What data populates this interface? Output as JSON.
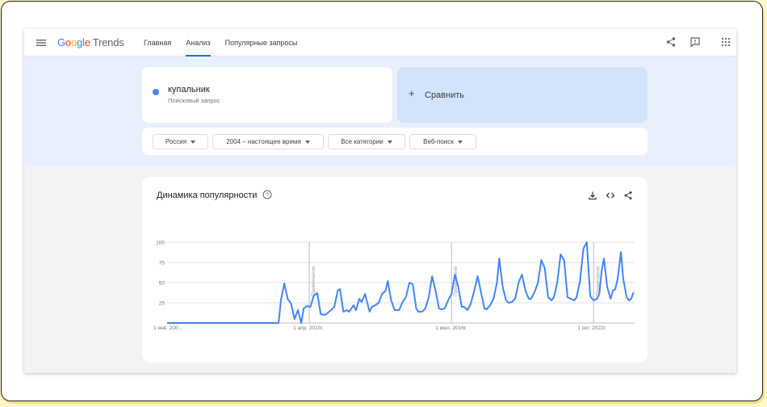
{
  "app": {
    "logo_google": "Google",
    "logo_trends": "Trends",
    "nav": [
      "Главная",
      "Анализ",
      "Популярные запросы"
    ],
    "active_tab": 1
  },
  "search": {
    "term": "купальник",
    "term_type": "Поисковый запрос",
    "term_color": "#4285f4",
    "compare_label": "Сравнить"
  },
  "filters": {
    "region": "Россия",
    "period": "2004 – настоящее время",
    "category": "Все категории",
    "search_type": "Веб-поиск"
  },
  "chart_data": {
    "type": "line",
    "title": "Динамика популярности",
    "x_tick_labels": [
      "1 янв. 200...",
      "1 апр. 2010г.",
      "1 июл. 2016г.",
      "1 окт. 2022г."
    ],
    "y_ticks": [
      100,
      75,
      50,
      25
    ],
    "ylim": [
      0,
      100
    ],
    "annotation_label": "Примечание",
    "series": [
      {
        "color": "#4285f4",
        "points": [
          [
            2004.0,
            0
          ],
          [
            2005.0,
            0
          ],
          [
            2006.0,
            0
          ],
          [
            2007.0,
            0
          ],
          [
            2008.0,
            0
          ],
          [
            2008.5,
            0
          ],
          [
            2008.9,
            0
          ],
          [
            2009.0,
            28
          ],
          [
            2009.15,
            49
          ],
          [
            2009.3,
            30
          ],
          [
            2009.45,
            24
          ],
          [
            2009.6,
            5
          ],
          [
            2009.75,
            16
          ],
          [
            2009.9,
            0
          ],
          [
            2010.0,
            18
          ],
          [
            2010.15,
            21
          ],
          [
            2010.3,
            20
          ],
          [
            2010.45,
            34
          ],
          [
            2010.6,
            37
          ],
          [
            2010.75,
            11
          ],
          [
            2010.9,
            10
          ],
          [
            2011.0,
            11
          ],
          [
            2011.2,
            16
          ],
          [
            2011.35,
            20
          ],
          [
            2011.5,
            40
          ],
          [
            2011.6,
            42
          ],
          [
            2011.75,
            14
          ],
          [
            2011.9,
            16
          ],
          [
            2012.0,
            14
          ],
          [
            2012.2,
            22
          ],
          [
            2012.3,
            16
          ],
          [
            2012.45,
            30
          ],
          [
            2012.55,
            26
          ],
          [
            2012.7,
            36
          ],
          [
            2012.9,
            14
          ],
          [
            2013.0,
            20
          ],
          [
            2013.15,
            22
          ],
          [
            2013.3,
            25
          ],
          [
            2013.45,
            36
          ],
          [
            2013.6,
            40
          ],
          [
            2013.7,
            52
          ],
          [
            2013.85,
            28
          ],
          [
            2014.0,
            16
          ],
          [
            2014.2,
            16
          ],
          [
            2014.35,
            26
          ],
          [
            2014.5,
            32
          ],
          [
            2014.65,
            50
          ],
          [
            2014.8,
            48
          ],
          [
            2014.95,
            18
          ],
          [
            2015.05,
            14
          ],
          [
            2015.2,
            14
          ],
          [
            2015.35,
            18
          ],
          [
            2015.5,
            32
          ],
          [
            2015.65,
            58
          ],
          [
            2015.8,
            40
          ],
          [
            2015.95,
            18
          ],
          [
            2016.05,
            17
          ],
          [
            2016.2,
            18
          ],
          [
            2016.35,
            28
          ],
          [
            2016.5,
            36
          ],
          [
            2016.65,
            60
          ],
          [
            2016.8,
            45
          ],
          [
            2016.95,
            20
          ],
          [
            2017.05,
            20
          ],
          [
            2017.2,
            16
          ],
          [
            2017.35,
            24
          ],
          [
            2017.5,
            40
          ],
          [
            2017.65,
            58
          ],
          [
            2017.8,
            38
          ],
          [
            2017.95,
            18
          ],
          [
            2018.05,
            17
          ],
          [
            2018.2,
            22
          ],
          [
            2018.35,
            30
          ],
          [
            2018.5,
            50
          ],
          [
            2018.6,
            80
          ],
          [
            2018.75,
            45
          ],
          [
            2018.9,
            28
          ],
          [
            2019.0,
            25
          ],
          [
            2019.15,
            26
          ],
          [
            2019.3,
            30
          ],
          [
            2019.45,
            50
          ],
          [
            2019.6,
            60
          ],
          [
            2019.75,
            40
          ],
          [
            2019.9,
            30
          ],
          [
            2020.0,
            30
          ],
          [
            2020.15,
            38
          ],
          [
            2020.3,
            50
          ],
          [
            2020.45,
            78
          ],
          [
            2020.6,
            68
          ],
          [
            2020.75,
            32
          ],
          [
            2020.9,
            28
          ],
          [
            2021.0,
            32
          ],
          [
            2021.15,
            50
          ],
          [
            2021.3,
            85
          ],
          [
            2021.45,
            78
          ],
          [
            2021.6,
            32
          ],
          [
            2021.75,
            30
          ],
          [
            2021.9,
            28
          ],
          [
            2022.0,
            32
          ],
          [
            2022.15,
            52
          ],
          [
            2022.3,
            92
          ],
          [
            2022.45,
            100
          ],
          [
            2022.6,
            33
          ],
          [
            2022.75,
            28
          ],
          [
            2022.9,
            30
          ],
          [
            2023.0,
            36
          ],
          [
            2023.1,
            64
          ],
          [
            2023.2,
            80
          ],
          [
            2023.35,
            44
          ],
          [
            2023.5,
            30
          ],
          [
            2023.6,
            40
          ],
          [
            2023.7,
            42
          ],
          [
            2023.8,
            54
          ],
          [
            2023.95,
            88
          ],
          [
            2024.05,
            55
          ],
          [
            2024.2,
            32
          ],
          [
            2024.3,
            28
          ],
          [
            2024.4,
            30
          ],
          [
            2024.5,
            38
          ]
        ]
      }
    ]
  }
}
